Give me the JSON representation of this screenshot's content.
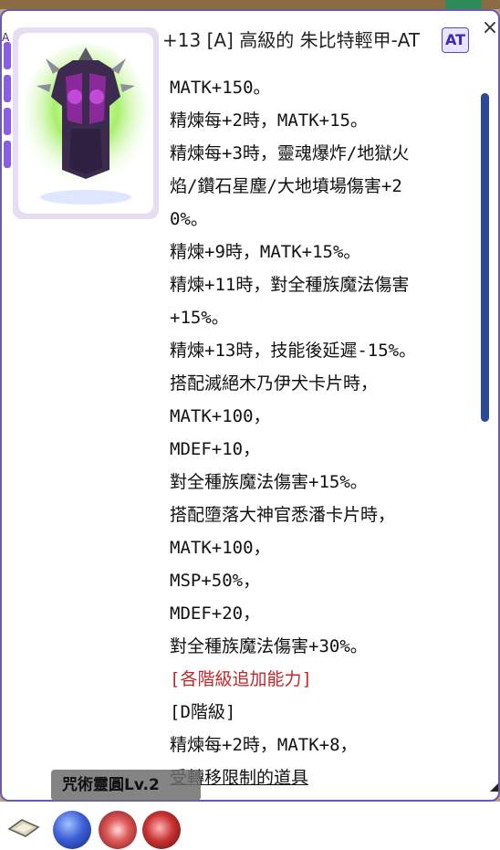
{
  "window": {
    "title": "+13 [A] 高級的 朱比特輕甲-AT",
    "corner_tag": "A",
    "sort_label": "AT",
    "close_label": "×"
  },
  "item": {
    "icon": "armor-icon"
  },
  "description": {
    "lines": [
      "MATK+150。",
      "精煉每+2時，MATK+15。",
      "精煉每+3時，靈魂爆炸/地獄火",
      "焰/鑽石星塵/大地墳場傷害+2",
      "0%。",
      "精煉+9時，MATK+15%。",
      "精煉+11時，對全種族魔法傷害",
      "+15%。",
      "精煉+13時，技能後延遲-15%。",
      "搭配滅絕木乃伊犬卡片時，",
      "MATK+100，",
      "MDEF+10，",
      "對全種族魔法傷害+15%。",
      "搭配墮落大神官悉潘卡片時，",
      "MATK+100，",
      "MSP+50%，",
      "MDEF+20，",
      "對全種族魔法傷害+30%。",
      "[各階級追加能力]",
      "[D階級]",
      "精煉每+2時，MATK+8，",
      "受轉移限制的道具"
    ],
    "red_line_index": 18,
    "underline_line_index": 21
  },
  "tooltip": {
    "text": "咒術靈圓Lv.2"
  },
  "hotbar": {
    "slots": [
      "map-icon",
      "blue-orb-icon",
      "pink-orb-icon",
      "red-orb-icon"
    ]
  },
  "colors": {
    "border": "#6a5ab0",
    "red_text": "#c0282a",
    "scroll_thumb": "#2a4a96"
  }
}
